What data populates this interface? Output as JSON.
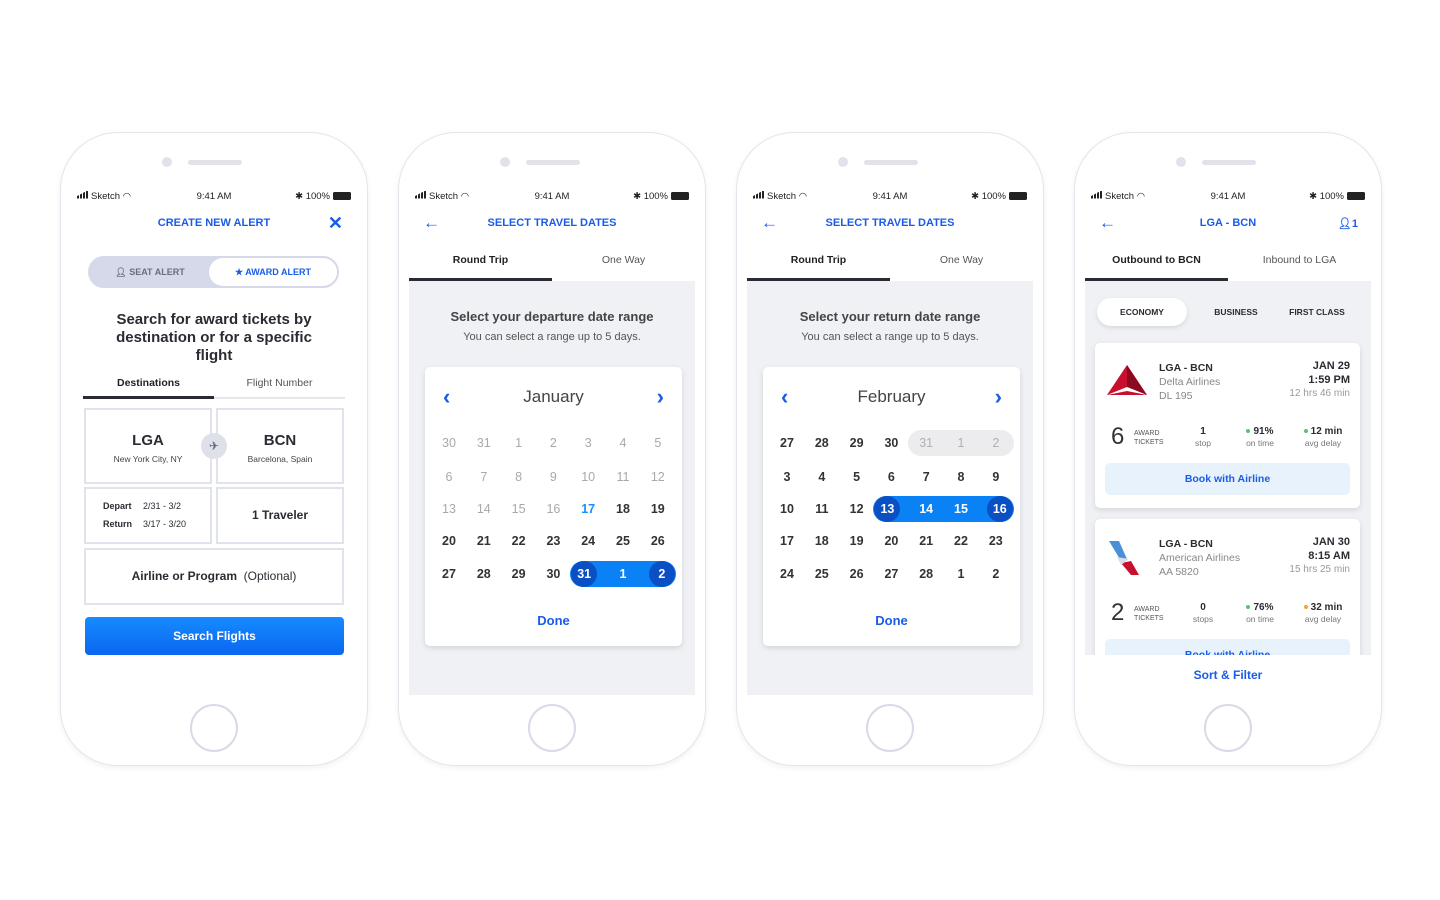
{
  "colors": {
    "accent": "#1a5ce6",
    "button": "#0a72ff",
    "range": "#0a82f5",
    "range_end": "#0b4fc4",
    "background": "#f0f1f5",
    "green": "#5cc36b",
    "orange": "#f2a530"
  },
  "status_bar": {
    "carrier": "Sketch",
    "time": "9:41 AM",
    "battery": "100%"
  },
  "screen1": {
    "title": "CREATE NEW ALERT",
    "close_icon": "close-icon",
    "toggle": {
      "seat": "SEAT ALERT",
      "award": "AWARD ALERT",
      "active": "award"
    },
    "heading": "Search for award tickets by destination or for a specific flight",
    "tabs": [
      "Destinations",
      "Flight Number"
    ],
    "origin": {
      "code": "LGA",
      "city": "New York City, NY"
    },
    "destination": {
      "code": "BCN",
      "city": "Barcelona, Spain"
    },
    "depart_label": "Depart",
    "depart_value": "2/31 - 3/2",
    "return_label": "Return",
    "return_value": "3/17 - 3/20",
    "travelers": "1 Traveler",
    "airline_label": "Airline or Program",
    "airline_optional": "(Optional)",
    "search_button": "Search Flights"
  },
  "screen2": {
    "title": "SELECT TRAVEL DATES",
    "tabs": [
      "Round Trip",
      "One Way"
    ],
    "heading": "Select your departure date range",
    "subheading": "You can select a range up to 5 days.",
    "month": "January",
    "done": "Done",
    "weeks": [
      [
        [
          "30",
          "muted"
        ],
        [
          "31",
          "muted"
        ],
        [
          "1",
          "muted"
        ],
        [
          "2",
          "muted"
        ],
        [
          "3",
          "muted"
        ],
        [
          "4",
          "muted"
        ],
        [
          "5",
          "muted"
        ]
      ],
      [
        [
          "6",
          "muted"
        ],
        [
          "7",
          "muted"
        ],
        [
          "8",
          "muted"
        ],
        [
          "9",
          "muted"
        ],
        [
          "10",
          "muted"
        ],
        [
          "11",
          "muted"
        ],
        [
          "12",
          "muted"
        ]
      ],
      [
        [
          "13",
          "muted"
        ],
        [
          "14",
          "muted"
        ],
        [
          "15",
          "muted"
        ],
        [
          "16",
          "muted"
        ],
        [
          "17",
          "today"
        ],
        [
          "18",
          ""
        ],
        [
          "19",
          ""
        ]
      ],
      [
        [
          "20",
          ""
        ],
        [
          "21",
          ""
        ],
        [
          "22",
          ""
        ],
        [
          "23",
          ""
        ],
        [
          "24",
          ""
        ],
        [
          "25",
          ""
        ],
        [
          "26",
          ""
        ]
      ],
      [
        [
          "27",
          ""
        ],
        [
          "28",
          ""
        ],
        [
          "29",
          ""
        ],
        [
          "30",
          ""
        ],
        [
          "31",
          "start"
        ],
        [
          "1",
          "mid"
        ],
        [
          "2",
          "end"
        ]
      ]
    ]
  },
  "screen3": {
    "title": "SELECT TRAVEL DATES",
    "tabs": [
      "Round Trip",
      "One Way"
    ],
    "heading": "Select your return date range",
    "subheading": "You can select a range up to 5 days.",
    "month": "February",
    "done": "Done",
    "weeks": [
      [
        [
          "27",
          ""
        ],
        [
          "28",
          ""
        ],
        [
          "29",
          ""
        ],
        [
          "30",
          ""
        ],
        [
          "31",
          "dis-start"
        ],
        [
          "1",
          "dis"
        ],
        [
          "2",
          "dis-end"
        ]
      ],
      [
        [
          "3",
          ""
        ],
        [
          "4",
          ""
        ],
        [
          "5",
          ""
        ],
        [
          "6",
          ""
        ],
        [
          "7",
          ""
        ],
        [
          "8",
          ""
        ],
        [
          "9",
          ""
        ]
      ],
      [
        [
          "10",
          ""
        ],
        [
          "11",
          ""
        ],
        [
          "12",
          ""
        ],
        [
          "13",
          "start"
        ],
        [
          "14",
          "mid"
        ],
        [
          "15",
          "mid"
        ],
        [
          "16",
          "end"
        ]
      ],
      [
        [
          "17",
          ""
        ],
        [
          "18",
          ""
        ],
        [
          "19",
          ""
        ],
        [
          "20",
          ""
        ],
        [
          "21",
          ""
        ],
        [
          "22",
          ""
        ],
        [
          "23",
          ""
        ]
      ],
      [
        [
          "24",
          ""
        ],
        [
          "25",
          ""
        ],
        [
          "26",
          ""
        ],
        [
          "27",
          ""
        ],
        [
          "28",
          ""
        ],
        [
          "1",
          ""
        ],
        [
          "2",
          ""
        ]
      ]
    ]
  },
  "screen4": {
    "title": "LGA - BCN",
    "travelers": "1",
    "tabs": [
      "Outbound to BCN",
      "Inbound to LGA"
    ],
    "classes": [
      "ECONOMY",
      "BUSINESS",
      "FIRST CLASS"
    ],
    "flights": [
      {
        "route": "LGA - BCN",
        "airline": "Delta Airlines",
        "flight": "DL 195",
        "date": "JAN 29",
        "time": "1:59 PM",
        "duration": "12 hrs 46 min",
        "tickets": "6",
        "tickets_label1": "AWARD",
        "tickets_label2": "TICKETS",
        "stops": "1",
        "stops_label": "stop",
        "on_time": "91%",
        "on_time_label": "on time",
        "on_time_status": "green",
        "delay": "12 min",
        "delay_label": "avg delay",
        "delay_status": "green",
        "book": "Book with Airline"
      },
      {
        "route": "LGA - BCN",
        "airline": "American Airlines",
        "flight": "AA 5820",
        "date": "JAN 30",
        "time": "8:15 AM",
        "duration": "15 hrs 25 min",
        "tickets": "2",
        "tickets_label1": "AWARD",
        "tickets_label2": "TICKETS",
        "stops": "0",
        "stops_label": "stops",
        "on_time": "76%",
        "on_time_label": "on time",
        "on_time_status": "green",
        "delay": "32 min",
        "delay_label": "avg delay",
        "delay_status": "orange",
        "book": "Book with Airline"
      }
    ],
    "sort_filter": "Sort & Filter"
  }
}
